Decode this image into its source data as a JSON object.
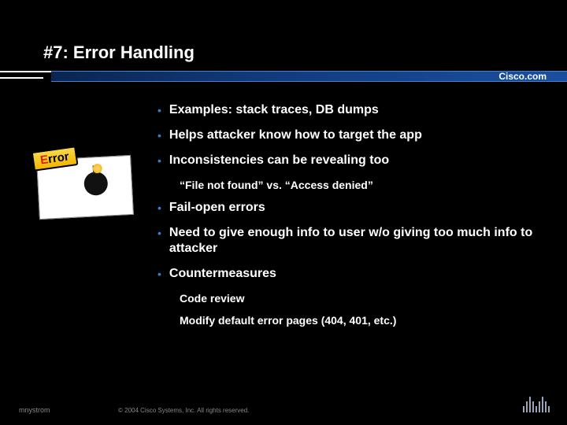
{
  "title": "#7: Error Handling",
  "brand": "Cisco.com",
  "bullets": {
    "b0": "Examples: stack traces, DB dumps",
    "b1": "Helps attacker know how to target the app",
    "b2": "Inconsistencies can be revealing too",
    "b2_sub0": "“File not found” vs. “Access denied”",
    "b3": "Fail-open errors",
    "b4": "Need to give enough info to user w/o giving too much info to attacker",
    "b5": "Countermeasures",
    "b5_sub0": "Code review",
    "b5_sub1": "Modify default error pages (404, 401, etc.)"
  },
  "error_graphic": {
    "label_first": "E",
    "label_rest": "rror"
  },
  "footer": {
    "author": "mnystrom",
    "copyright": "© 2004 Cisco Systems, Inc. All rights reserved."
  }
}
